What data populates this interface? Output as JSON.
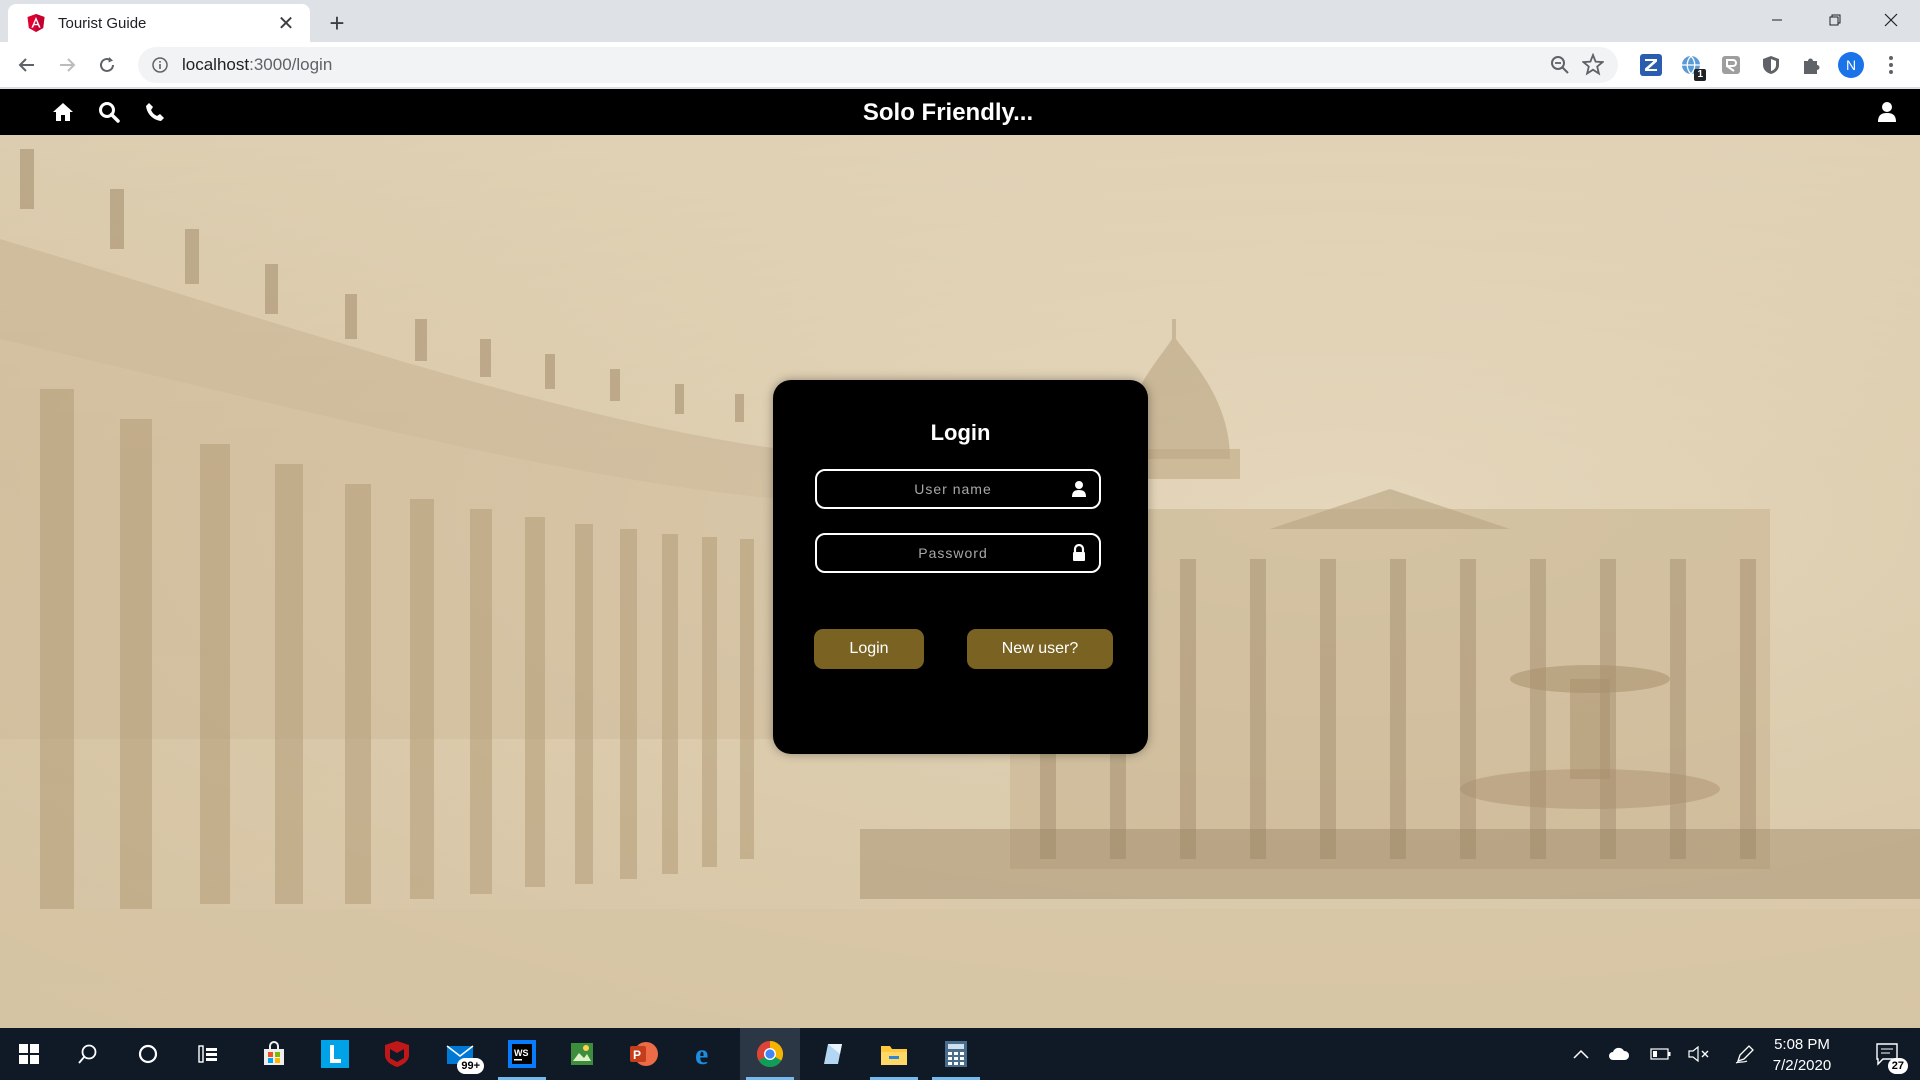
{
  "browser": {
    "tab_title": "Tourist Guide",
    "url_host": "localhost",
    "url_path": ":3000/login",
    "extension_badge": "1",
    "profile_initial": "N"
  },
  "app": {
    "brand": "Solo Friendly...",
    "nav_icons": [
      "home-icon",
      "search-icon",
      "phone-icon"
    ],
    "user_icon": "user-icon"
  },
  "login": {
    "title": "Login",
    "username_placeholder": "User name",
    "password_placeholder": "Password",
    "login_button": "Login",
    "new_user_button": "New user?",
    "button_color": "#7a6322"
  },
  "taskbar": {
    "mail_badge": "99+",
    "time": "5:08 PM",
    "date": "7/2/2020",
    "notification_count": "27"
  }
}
